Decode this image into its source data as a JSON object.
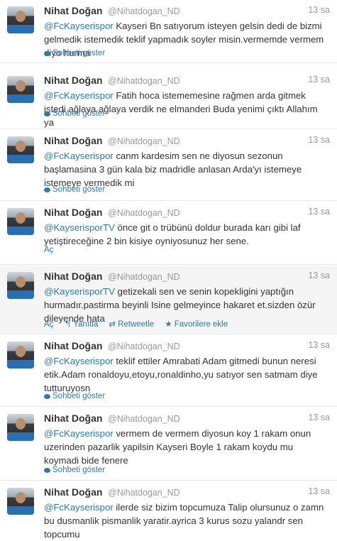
{
  "tweets": [
    {
      "name": "Nihat Doğan",
      "handle": "@Nihatdogan_ND",
      "time": "13 sa",
      "mention": "@FcKayserispor",
      "body": " Kayseri Bn satıyorum isteyen gelsin dedi de bizmi gelmedik istemedik teklif yapmadık soyler misin.vermemde vermem diyo hurma",
      "action": "Sohbeti göster"
    },
    {
      "name": "Nihat Doğan",
      "handle": "@Nihatdogan_ND",
      "time": "13 sa",
      "mention": "@FcKayserispor",
      "body": " Fatih hoca istememesine rağmen arda gitmek istedi ağlaya ağlaya verdik ne elmanderi Buda yenimi çıktı Allahım ya",
      "action": "Sohbeti göster"
    },
    {
      "name": "Nihat Doğan",
      "handle": "@Nihatdogan_ND",
      "time": "13 sa",
      "mention": "@FcKayserispor",
      "body": " canm kardesim sen ne diyosun sezonun başlamasina 3 gün kala biz madridle anlasan Arda'yı istemeye istemeye vermedik mi",
      "action": "Sohbeti göster"
    },
    {
      "name": "Nihat Doğan",
      "handle": "@Nihatdogan_ND",
      "time": "13 sa",
      "mention": "@KayserisporTV",
      "body": " önce git o trübünü doldur burada karı gibi laf yetiştireceğine 2 bin kisiye oyniyosunuz her sene.",
      "action": "Aç"
    },
    {
      "name": "Nihat Doğan",
      "handle": "@Nihatdogan_ND",
      "time": "13 sa",
      "mention": "@KayserisporTV",
      "body": " getizekali sen ve senin kopekligini yaptığın hurmadır.pastirma beyinli Isine gelmeyince hakaret et.sizden özür dileyende hata",
      "actions": {
        "open": "Aç",
        "reply": "Yanıtla",
        "retweet": "Retweetle",
        "favorite": "Favorilere ekle"
      }
    },
    {
      "name": "Nihat Doğan",
      "handle": "@Nihatdogan_ND",
      "time": "13 sa",
      "mention": "@FcKayserispor",
      "body": " teklif ettiler Amrabati Adam gitmedi bunun neresi etik.Adam ronaldoyu,etoyu,ronaldinho,yu satıyor sen satmam diye tutturuyosn",
      "action": "Sohbeti göster"
    },
    {
      "name": "Nihat Doğan",
      "handle": "@Nihatdogan_ND",
      "time": "13 sa",
      "mention": "@FcKayserispor",
      "body": " vermem de vermem diyosun koy 1 rakam onun uzerinden pazarlik yapilsin Kayseri Boyle 1 rakam koydu mu koymadi bide fenere",
      "action": "Sohbeti göster"
    },
    {
      "name": "Nihat Doğan",
      "handle": "@Nihatdogan_ND",
      "time": "13 sa",
      "mention": "@FcKayserispor",
      "body": " ilerde siz bizim topcumuza Talip olursunuz o zamn bu dusmanlik pismanlik yaratir.ayrica 3 kurus sozu yalandr sen topcumu"
    }
  ],
  "colors": {
    "link": "#2a7ab0",
    "hover_bg": "#f5f5f5"
  }
}
